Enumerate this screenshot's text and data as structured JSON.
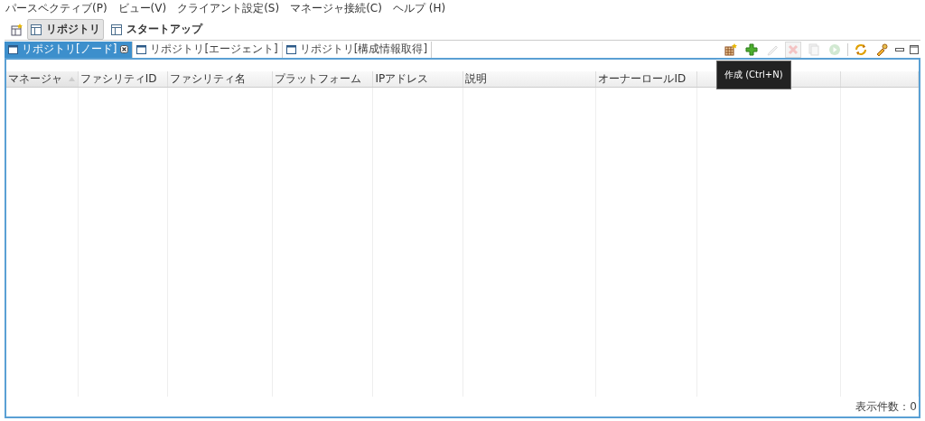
{
  "menu": [
    "パースペクティブ(P)",
    "ビュー(V)",
    "クライアント設定(S)",
    "マネージャ接続(C)",
    "ヘルプ (H)"
  ],
  "perspectives": [
    {
      "label": "リポジトリ",
      "selected": true
    },
    {
      "label": "スタートアップ",
      "selected": false
    }
  ],
  "tabs": [
    {
      "label": "リポジトリ[ノード]",
      "selected": true
    },
    {
      "label": "リポジトリ[エージェント]",
      "selected": false
    },
    {
      "label": "リポジトリ[構成情報取得]",
      "selected": false
    }
  ],
  "toolbar": [
    {
      "kind": "grid",
      "disabled": false
    },
    {
      "kind": "add",
      "disabled": false
    },
    {
      "kind": "edit",
      "disabled": true
    },
    {
      "kind": "delete",
      "disabled": true
    },
    {
      "kind": "copy",
      "disabled": true
    },
    {
      "kind": "run",
      "disabled": true
    },
    {
      "kind": "sep"
    },
    {
      "kind": "refresh",
      "disabled": false
    },
    {
      "kind": "key",
      "disabled": false
    }
  ],
  "tooltip": "作成 (Ctrl+N)",
  "table": {
    "columns": [
      {
        "label": "マネージャ",
        "sorted": true
      },
      {
        "label": "ファシリティID",
        "sorted": false
      },
      {
        "label": "ファシリティ名",
        "sorted": false
      },
      {
        "label": "プラットフォーム",
        "sorted": false
      },
      {
        "label": "IPアドレス",
        "sorted": false
      },
      {
        "label": "説明",
        "sorted": false
      },
      {
        "label": "オーナーロールID",
        "sorted": false
      },
      {
        "sorted": false
      },
      {
        "sorted": false
      }
    ]
  },
  "status": "表示件数：0"
}
